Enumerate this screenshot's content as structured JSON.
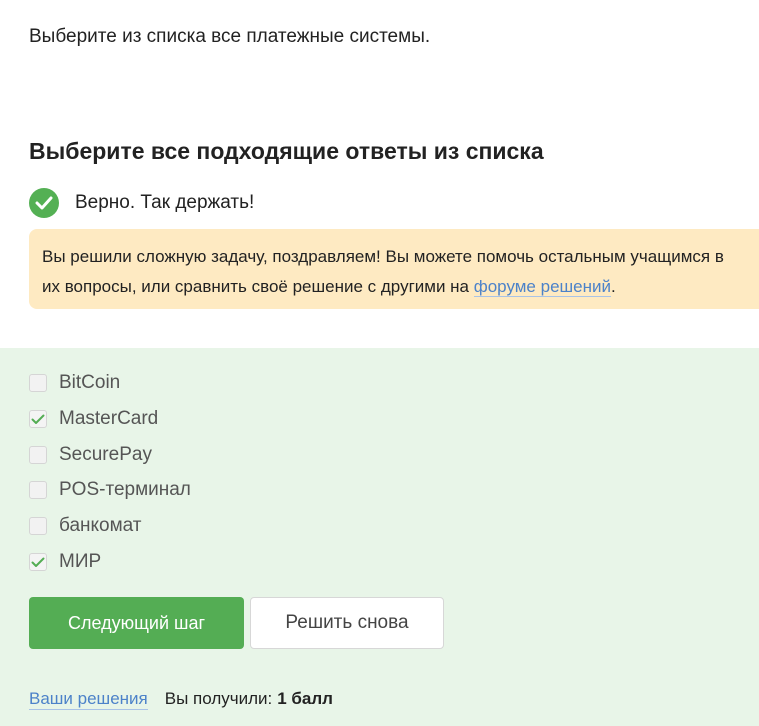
{
  "question": "Выберите из списка все платежные системы.",
  "task_heading": "Выберите все подходящие ответы из списка",
  "result": {
    "text": "Верно. Так держать!",
    "icon": "check-circle-icon",
    "color": "#54b054"
  },
  "hint": {
    "line1": "Вы решили сложную задачу, поздравляем! Вы можете помочь остальным учащимся в",
    "line2_prefix": "их вопросы, или сравнить своё решение с другими на ",
    "link": "форуме решений",
    "line2_suffix": ".",
    "background": "#feeac2"
  },
  "options": [
    {
      "label": "BitCoin",
      "checked": false
    },
    {
      "label": "MasterCard",
      "checked": true
    },
    {
      "label": "SecurePay",
      "checked": false
    },
    {
      "label": "POS-терминал",
      "checked": false
    },
    {
      "label": "банкомат",
      "checked": false
    },
    {
      "label": "МИР",
      "checked": true
    }
  ],
  "buttons": {
    "next": "Следующий шаг",
    "retry": "Решить снова"
  },
  "footer": {
    "solutions_link": "Ваши решения",
    "score_label": "Вы получили:",
    "score_value": "1 балл"
  },
  "colors": {
    "accent_green": "#54ad54",
    "answers_background": "#e8f5e8",
    "link": "#4c82c9"
  }
}
